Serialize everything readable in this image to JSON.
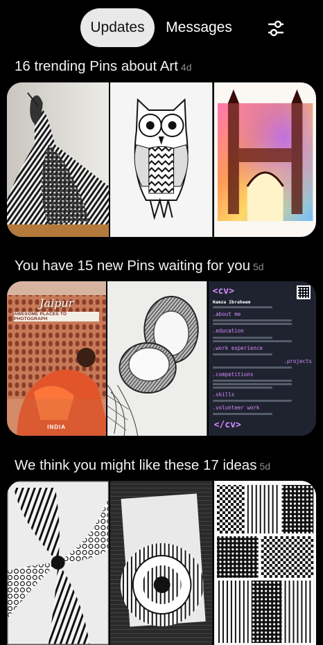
{
  "header": {
    "tabs": [
      {
        "label": "Updates",
        "active": true
      },
      {
        "label": "Messages",
        "active": false
      }
    ],
    "filter_icon": "sliders-icon"
  },
  "sections": [
    {
      "title": "16 trending Pins about Art",
      "age": "4d",
      "pins": [
        "zentangle-dancer-drawing",
        "zentangle-owl-drawing",
        "watercolor-charminar-painting"
      ]
    },
    {
      "title": "You have 15 new Pins waiting for you",
      "age": "5d",
      "pins": [
        {
          "name": "jaipur-travel-pin",
          "title": "Jaipur",
          "banner": "AWESOME PLACES TO PHOTOGRAPH",
          "footer": "INDIA"
        },
        {
          "name": "coconut-pencil-sketch"
        },
        {
          "name": "cv-resume-pin",
          "tag": "<cv>",
          "name_text": "Hamza Ibraheem",
          "headings": [
            ".about me",
            ".education",
            ".work experience",
            ".projects",
            ".competitions",
            ".skills",
            ".volunteer work"
          ],
          "footer": "</cv>"
        }
      ]
    },
    {
      "title": "We think you might like these 17 ideas",
      "age": "5d",
      "pins": [
        "zentangle-spiral-art",
        "mandala-notebook-art",
        "zentangle-pattern-grid"
      ]
    }
  ],
  "colors": {
    "background": "#000000",
    "active_tab_bg": "#e9e9e9",
    "age_text": "#8e8e8e",
    "cv_accent": "#d68bff"
  }
}
